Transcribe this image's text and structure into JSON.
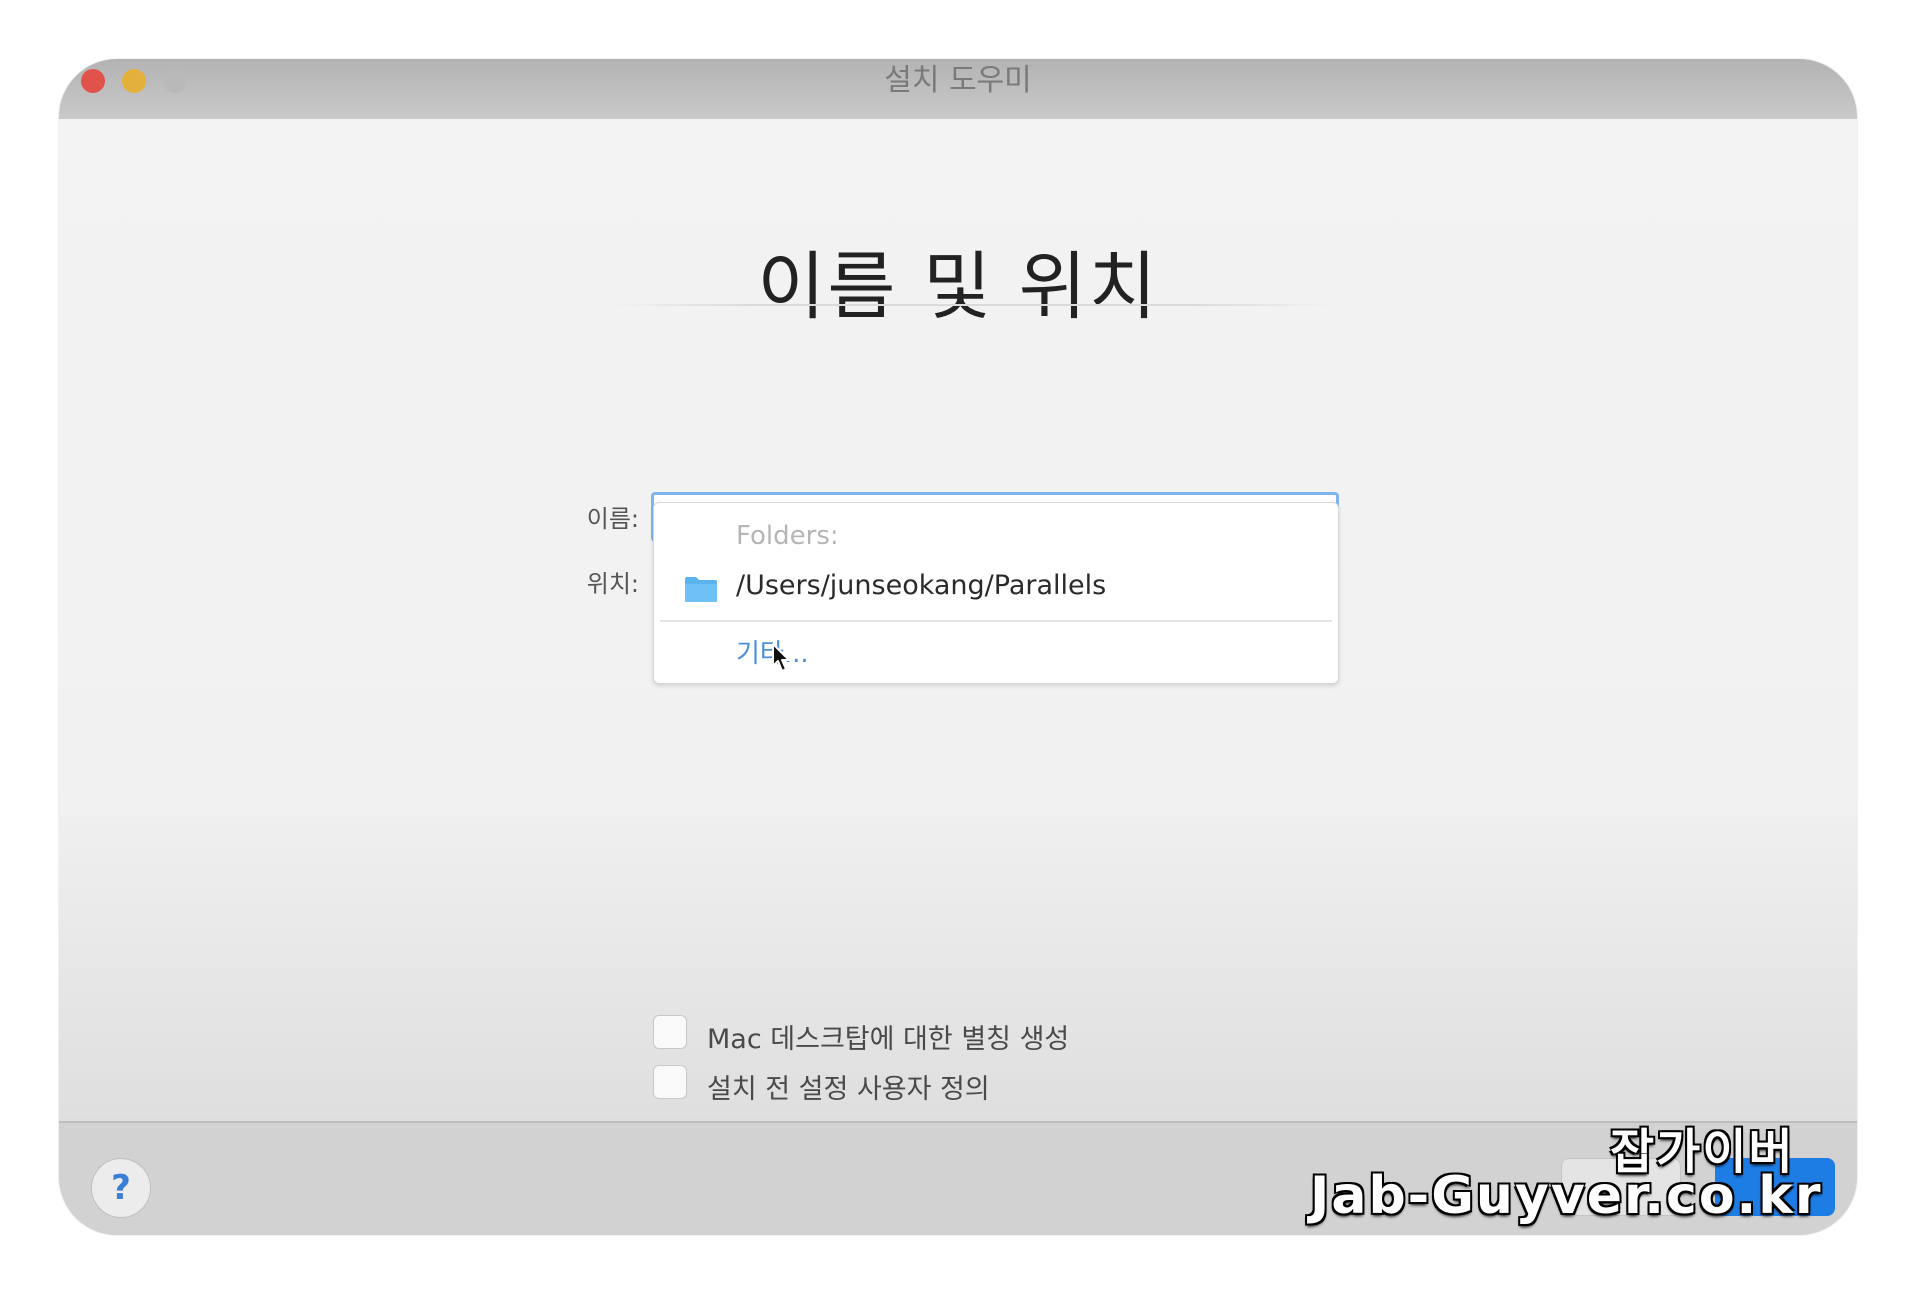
{
  "window": {
    "title": "설치 도우미",
    "traffic_lights": {
      "close_color": "#e1524a",
      "minimize_color": "#e2b03b",
      "maximize_color": "#b9b9b9"
    }
  },
  "page": {
    "title": "이름 및 위치"
  },
  "form": {
    "name_label": "이름:",
    "name_value": "",
    "location_label": "위치:"
  },
  "location_dropdown": {
    "header": "Folders:",
    "items": [
      {
        "icon": "folder-icon",
        "label": "/Users/junseokang/Parallels"
      }
    ],
    "other_label": "기타...",
    "accent_color": "#4a90d9"
  },
  "options": [
    {
      "label": "Mac 데스크탑에 대한 별칭 생성",
      "checked": false
    },
    {
      "label": "설치 전 설정 사용자 정의",
      "checked": false
    }
  ],
  "footer": {
    "help_label": "?",
    "primary_button_color": "#1d7de5"
  },
  "watermark": {
    "line1": "잡가이버",
    "line2": "Jab-Guyver.co.kr"
  }
}
